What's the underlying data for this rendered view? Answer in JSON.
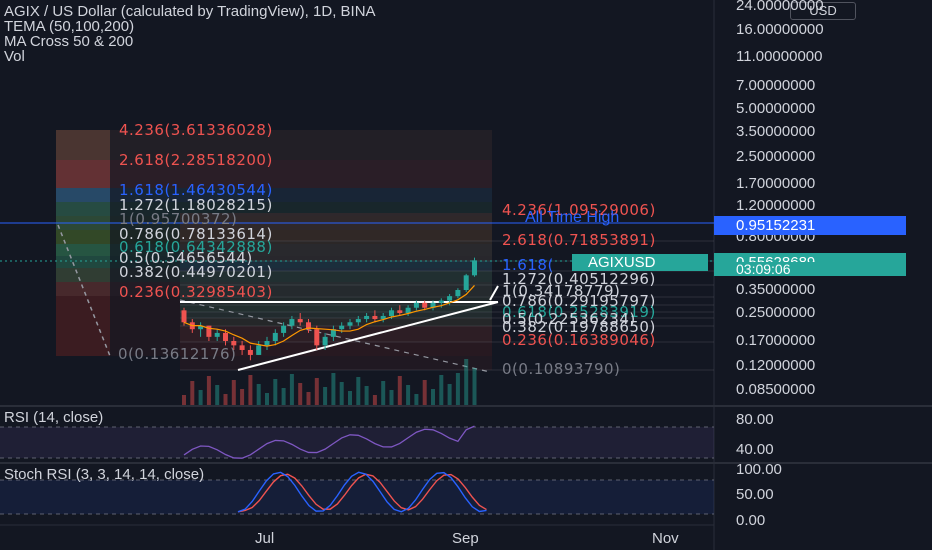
{
  "header": {
    "title": "AGIX / US Dollar (calculated by TradingView), 1D, BINA",
    "indicators": [
      "TEMA (50,100,200)",
      "MA Cross 50 & 200",
      "Vol"
    ]
  },
  "currency_label": "USD",
  "tags": {
    "ath_label": "All Time High",
    "ath_price": "0.95152231",
    "symbol": "AGIXUSD",
    "last_price": "0.55628689",
    "countdown": "03:09:06"
  },
  "colors": {
    "bg": "#131722",
    "up": "#26a69a",
    "down": "#ef5350",
    "blue": "#2962ff",
    "text": "#d1d4dc",
    "rsi": "#7e57c2",
    "stoch_k": "#2962ff",
    "stoch_d": "#ef5350"
  },
  "fib_left": [
    {
      "text": "4.236(3.61336028)",
      "color": "#ef5350"
    },
    {
      "text": "2.618(2.28518200)",
      "color": "#ef5350"
    },
    {
      "text": "1.618(1.46430544)",
      "color": "#2962ff"
    },
    {
      "text": "1.272(1.18028215)",
      "color": "#d1d4dc"
    },
    {
      "text": "1(0.95700372)",
      "color": "#787b86"
    },
    {
      "text": "0.786(0.78133614)",
      "color": "#d1d4dc"
    },
    {
      "text": "0.618(0.64342888)",
      "color": "#26a69a"
    },
    {
      "text": "0.5(0.54656544)",
      "color": "#d1d4dc"
    },
    {
      "text": "0.382(0.44970201)",
      "color": "#d1d4dc"
    },
    {
      "text": "0.236(0.32985403)",
      "color": "#ef5350"
    },
    {
      "text": "0(0.13612176)",
      "color": "#787b86"
    }
  ],
  "fib_right": [
    {
      "text": "4.236(1.09529006)",
      "color": "#ef5350"
    },
    {
      "text": "2.618(0.71853891)",
      "color": "#ef5350"
    },
    {
      "text": "1.618(",
      "color": "#2962ff"
    },
    {
      "text": "1.272(0.40512296)",
      "color": "#d1d4dc"
    },
    {
      "text": "1(0.34178779)",
      "color": "#d1d4dc"
    },
    {
      "text": "0.786(0.29195797)",
      "color": "#d1d4dc"
    },
    {
      "text": "0.618(0.25283919)",
      "color": "#26a69a"
    },
    {
      "text": "0.5(0.22536234)",
      "color": "#d1d4dc"
    },
    {
      "text": "0.382(0.19788650)",
      "color": "#d1d4dc"
    },
    {
      "text": "0.236(0.16389046)",
      "color": "#ef5350"
    },
    {
      "text": "0(0.10893790)",
      "color": "#787b86"
    }
  ],
  "price_axis": [
    "24.00000000",
    "16.00000000",
    "11.00000000",
    "7.00000000",
    "5.00000000",
    "3.50000000",
    "2.50000000",
    "1.70000000",
    "1.20000000",
    "0.80000000",
    "0.35000000",
    "0.25000000",
    "0.17000000",
    "0.12000000",
    "0.08500000"
  ],
  "rsi": {
    "title": "RSI (14, close)",
    "levels": [
      "80.00",
      "40.00"
    ]
  },
  "stoch": {
    "title": "Stoch RSI (3, 3, 14, 14, close)",
    "levels": [
      "100.00",
      "50.00",
      "0.00"
    ]
  },
  "time_axis": [
    "Jul",
    "Sep",
    "Nov"
  ],
  "chart_data": {
    "type": "candlestick",
    "scale": "log",
    "price_range": [
      0.085,
      24.0
    ],
    "ohlc_approx": [
      [
        0.26,
        0.27,
        0.21,
        0.22
      ],
      [
        0.22,
        0.23,
        0.19,
        0.2
      ],
      [
        0.2,
        0.22,
        0.18,
        0.21
      ],
      [
        0.21,
        0.21,
        0.17,
        0.18
      ],
      [
        0.18,
        0.2,
        0.17,
        0.19
      ],
      [
        0.19,
        0.2,
        0.16,
        0.17
      ],
      [
        0.17,
        0.18,
        0.15,
        0.16
      ],
      [
        0.16,
        0.17,
        0.14,
        0.15
      ],
      [
        0.15,
        0.16,
        0.13,
        0.14
      ],
      [
        0.14,
        0.17,
        0.14,
        0.16
      ],
      [
        0.16,
        0.18,
        0.15,
        0.17
      ],
      [
        0.17,
        0.2,
        0.16,
        0.19
      ],
      [
        0.19,
        0.22,
        0.18,
        0.21
      ],
      [
        0.21,
        0.24,
        0.2,
        0.23
      ],
      [
        0.23,
        0.25,
        0.21,
        0.22
      ],
      [
        0.22,
        0.23,
        0.19,
        0.2
      ],
      [
        0.2,
        0.21,
        0.15,
        0.16
      ],
      [
        0.16,
        0.19,
        0.15,
        0.18
      ],
      [
        0.18,
        0.21,
        0.17,
        0.2
      ],
      [
        0.2,
        0.22,
        0.19,
        0.21
      ],
      [
        0.21,
        0.23,
        0.2,
        0.22
      ],
      [
        0.22,
        0.24,
        0.21,
        0.23
      ],
      [
        0.23,
        0.25,
        0.22,
        0.24
      ],
      [
        0.24,
        0.26,
        0.22,
        0.23
      ],
      [
        0.23,
        0.25,
        0.22,
        0.24
      ],
      [
        0.24,
        0.27,
        0.23,
        0.26
      ],
      [
        0.26,
        0.28,
        0.24,
        0.25
      ],
      [
        0.25,
        0.28,
        0.24,
        0.27
      ],
      [
        0.27,
        0.3,
        0.26,
        0.29
      ],
      [
        0.29,
        0.3,
        0.26,
        0.27
      ],
      [
        0.27,
        0.3,
        0.26,
        0.29
      ],
      [
        0.29,
        0.31,
        0.27,
        0.3
      ],
      [
        0.3,
        0.33,
        0.28,
        0.32
      ],
      [
        0.32,
        0.36,
        0.31,
        0.35
      ],
      [
        0.35,
        0.45,
        0.34,
        0.44
      ],
      [
        0.44,
        0.58,
        0.43,
        0.556
      ]
    ],
    "rsi_last": 82,
    "stoch_last": 85
  }
}
